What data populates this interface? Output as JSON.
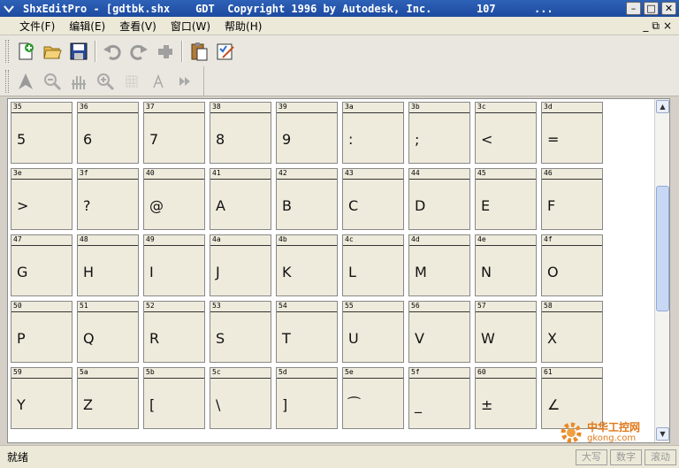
{
  "window": {
    "title": "ShxEditPro - [gdtbk.shx    GDT  Copyright 1996 by Autodesk, Inc.       107      ...",
    "minimize_label": "–",
    "maximize_label": "□",
    "close_label": "✕"
  },
  "menu": {
    "items": [
      {
        "label": "文件(F)"
      },
      {
        "label": "编辑(E)"
      },
      {
        "label": "查看(V)"
      },
      {
        "label": "窗口(W)"
      },
      {
        "label": "帮助(H)"
      }
    ],
    "mdi_minimize": "_",
    "mdi_restore": "⧉",
    "mdi_close": "×"
  },
  "toolbar1": {
    "icons": [
      "new-icon",
      "open-icon",
      "save-icon",
      "undo-icon",
      "redo-icon",
      "cut-icon",
      "paste-icon",
      "properties-icon"
    ]
  },
  "toolbar2": {
    "icons": [
      "pointer-icon",
      "zoom-out-icon",
      "pan-icon",
      "zoom-in-icon",
      "grid-icon",
      "text-icon",
      "run-icon"
    ]
  },
  "glyphs": [
    {
      "code": "35",
      "char": "5"
    },
    {
      "code": "36",
      "char": "6"
    },
    {
      "code": "37",
      "char": "7"
    },
    {
      "code": "38",
      "char": "8"
    },
    {
      "code": "39",
      "char": "9"
    },
    {
      "code": "3a",
      "char": ":"
    },
    {
      "code": "3b",
      "char": ";"
    },
    {
      "code": "3c",
      "char": "<"
    },
    {
      "code": "3d",
      "char": "="
    },
    {
      "code": "3e",
      "char": ">"
    },
    {
      "code": "3f",
      "char": "?"
    },
    {
      "code": "40",
      "char": "@"
    },
    {
      "code": "41",
      "char": "A"
    },
    {
      "code": "42",
      "char": "B"
    },
    {
      "code": "43",
      "char": "C"
    },
    {
      "code": "44",
      "char": "D"
    },
    {
      "code": "45",
      "char": "E"
    },
    {
      "code": "46",
      "char": "F"
    },
    {
      "code": "47",
      "char": "G"
    },
    {
      "code": "48",
      "char": "H"
    },
    {
      "code": "49",
      "char": "I"
    },
    {
      "code": "4a",
      "char": "J"
    },
    {
      "code": "4b",
      "char": "K"
    },
    {
      "code": "4c",
      "char": "L"
    },
    {
      "code": "4d",
      "char": "M"
    },
    {
      "code": "4e",
      "char": "N"
    },
    {
      "code": "4f",
      "char": "O"
    },
    {
      "code": "50",
      "char": "P"
    },
    {
      "code": "51",
      "char": "Q"
    },
    {
      "code": "52",
      "char": "R"
    },
    {
      "code": "53",
      "char": "S"
    },
    {
      "code": "54",
      "char": "T"
    },
    {
      "code": "55",
      "char": "U"
    },
    {
      "code": "56",
      "char": "V"
    },
    {
      "code": "57",
      "char": "W"
    },
    {
      "code": "58",
      "char": "X"
    },
    {
      "code": "59",
      "char": "Y"
    },
    {
      "code": "5a",
      "char": "Z"
    },
    {
      "code": "5b",
      "char": "["
    },
    {
      "code": "5c",
      "char": "\\"
    },
    {
      "code": "5d",
      "char": "]"
    },
    {
      "code": "5e",
      "char": "⁀"
    },
    {
      "code": "5f",
      "char": "_"
    },
    {
      "code": "60",
      "char": "±"
    },
    {
      "code": "61",
      "char": "∠"
    }
  ],
  "status": {
    "text": "就绪",
    "panes": [
      "大写",
      "数字",
      "滚动"
    ]
  },
  "watermark": {
    "brand": "中华工控网",
    "url": "gkong.com"
  },
  "colors": {
    "titlebar": "#1c4aa0",
    "cell_bg": "#efebdc",
    "watermark": "#e07818"
  }
}
